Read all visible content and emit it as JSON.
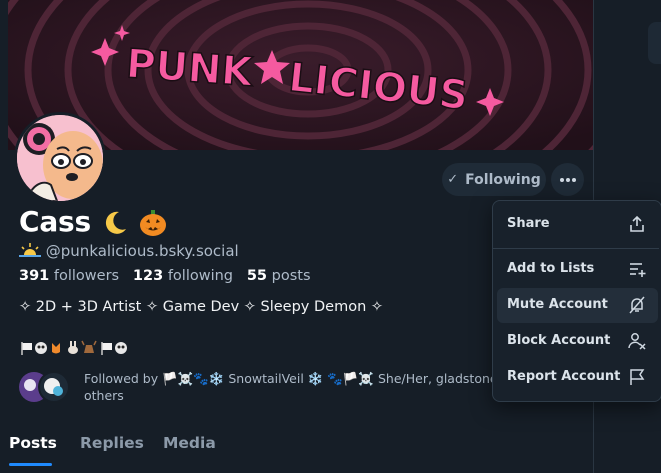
{
  "banner": {
    "title": "PUNKALICIOUS",
    "colors": {
      "bg": "#2a1620",
      "stripe": "#5a2a3c",
      "text": "#f55aa0"
    }
  },
  "profile": {
    "name": "Cass",
    "name_emoji": [
      "crescent-moon",
      "jack-o-lantern"
    ],
    "handle_icon": "sunrise",
    "handle": "@punkalicious.bsky.social",
    "followers_count": "391",
    "followers_label": "followers",
    "following_count": "123",
    "following_label": "following",
    "posts_count": "55",
    "posts_label": "posts",
    "bio": "✧ 2D + 3D Artist ✧ Game Dev ✧ Sleepy Demon ✧",
    "bio_emoji_line": [
      "white-flag",
      "skull",
      "fox",
      "rabbit",
      "deer",
      "white-flag",
      "skull"
    ]
  },
  "actions": {
    "following_label": "Following",
    "more_icon": "ellipsis-icon"
  },
  "followed_by": {
    "line1": "Followed by 🏳️☠️🐾❄️ SnowtailVeil ❄️ 🐾🏳️☠️ She/Her, gladstone 🎃",
    "line2": "others"
  },
  "tabs": [
    {
      "label": "Posts",
      "active": true
    },
    {
      "label": "Replies",
      "active": false
    },
    {
      "label": "Media",
      "active": false
    }
  ],
  "menu": {
    "items": [
      {
        "label": "Share",
        "icon": "share-icon"
      },
      {
        "label": "Add to Lists",
        "icon": "list-add-icon"
      },
      {
        "label": "Mute Account",
        "icon": "bell-mute-icon"
      },
      {
        "label": "Block Account",
        "icon": "person-block-icon"
      },
      {
        "label": "Report Account",
        "icon": "flag-icon"
      }
    ]
  },
  "colors": {
    "background": "#161e27",
    "accent": "#208bfe",
    "muted_text": "#aebbc9"
  }
}
